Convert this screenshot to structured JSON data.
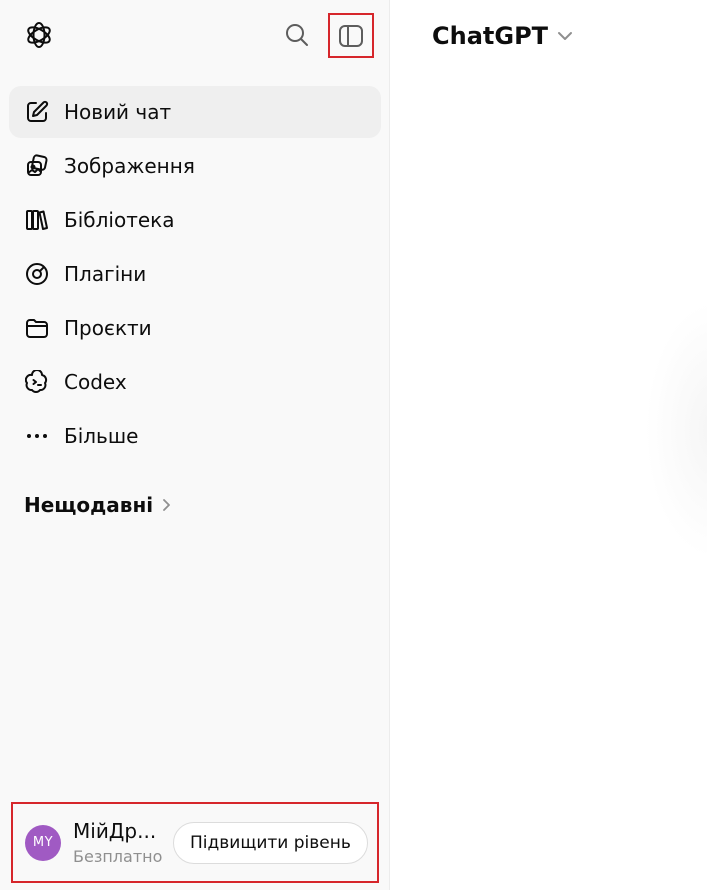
{
  "sidebar": {
    "items": [
      {
        "label": "Новий чат",
        "icon": "new-chat-icon"
      },
      {
        "label": "Зображення",
        "icon": "images-icon"
      },
      {
        "label": "Бібліотека",
        "icon": "library-icon"
      },
      {
        "label": "Плагіни",
        "icon": "plugins-icon"
      },
      {
        "label": "Проєкти",
        "icon": "folder-icon"
      },
      {
        "label": "Codex",
        "icon": "codex-icon"
      },
      {
        "label": "Більше",
        "icon": "more-icon"
      }
    ],
    "recent_label": "Нещодавні"
  },
  "account": {
    "initials": "MY",
    "name": "МійДр...",
    "plan": "Безплатно",
    "upgrade_label": "Підвищити рівень"
  },
  "header": {
    "model_name": "ChatGPT"
  },
  "colors": {
    "sidebar_bg": "#f9f9f9",
    "active_item_bg": "#efefef",
    "highlight_border": "#d6262b",
    "avatar_bg": "#a05ac3"
  }
}
